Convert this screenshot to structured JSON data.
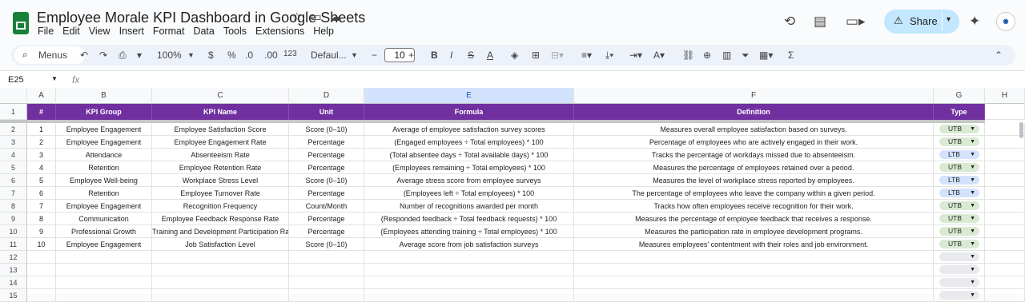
{
  "app": {
    "title": "Employee Morale KPI Dashboard in Google Sheets",
    "menus": [
      "File",
      "Edit",
      "View",
      "Insert",
      "Format",
      "Data",
      "Tools",
      "Extensions",
      "Help"
    ],
    "share_label": "Share"
  },
  "toolbar": {
    "search_label": "Menus",
    "zoom": "100%",
    "currency": "$",
    "percent": "%",
    "dec_decrease": ".0",
    "dec_increase": ".00",
    "number_format": "123",
    "font": "Defaul...",
    "font_size": "10"
  },
  "formula_bar": {
    "cell_ref": "E25",
    "fx": "fx",
    "value": ""
  },
  "columns": [
    "A",
    "B",
    "C",
    "D",
    "E",
    "F",
    "G",
    "H"
  ],
  "selected_column": "E",
  "header_row": {
    "row_number": "1",
    "cells": [
      "#",
      "KPI Group",
      "KPI Name",
      "Unit",
      "Formula",
      "Definition",
      "Type"
    ]
  },
  "rows": [
    {
      "row_number": "2",
      "num": "1",
      "group": "Employee Engagement",
      "name": "Employee Satisfaction Score",
      "unit": "Score (0–10)",
      "formula": "Average of employee satisfaction survey scores",
      "definition": "Measures overall employee satisfaction based on surveys.",
      "type": "UTB"
    },
    {
      "row_number": "3",
      "num": "2",
      "group": "Employee Engagement",
      "name": "Employee Engagement Rate",
      "unit": "Percentage",
      "formula": "(Engaged employees ÷ Total employees) * 100",
      "definition": "Percentage of employees who are actively engaged in their work.",
      "type": "UTB"
    },
    {
      "row_number": "4",
      "num": "3",
      "group": "Attendance",
      "name": "Absenteeism Rate",
      "unit": "Percentage",
      "formula": "(Total absentee days ÷ Total available days) * 100",
      "definition": "Tracks the percentage of workdays missed due to absenteeism.",
      "type": "LTB"
    },
    {
      "row_number": "5",
      "num": "4",
      "group": "Retention",
      "name": "Employee Retention Rate",
      "unit": "Percentage",
      "formula": "(Employees remaining ÷ Total employees) * 100",
      "definition": "Measures the percentage of employees retained over a period.",
      "type": "UTB"
    },
    {
      "row_number": "6",
      "num": "5",
      "group": "Employee Well-being",
      "name": "Workplace Stress Level",
      "unit": "Score (0–10)",
      "formula": "Average stress score from employee surveys",
      "definition": "Measures the level of workplace stress reported by employees.",
      "type": "LTB"
    },
    {
      "row_number": "7",
      "num": "6",
      "group": "Retention",
      "name": "Employee Turnover Rate",
      "unit": "Percentage",
      "formula": "(Employees left ÷ Total employees) * 100",
      "definition": "The percentage of employees who leave the company within a given period.",
      "type": "LTB"
    },
    {
      "row_number": "8",
      "num": "7",
      "group": "Employee Engagement",
      "name": "Recognition Frequency",
      "unit": "Count/Month",
      "formula": "Number of recognitions awarded per month",
      "definition": "Tracks how often employees receive recognition for their work.",
      "type": "UTB"
    },
    {
      "row_number": "9",
      "num": "8",
      "group": "Communication",
      "name": "Employee Feedback Response Rate",
      "unit": "Percentage",
      "formula": "(Responded feedback ÷ Total feedback requests) * 100",
      "definition": "Measures the percentage of employee feedback that receives a response.",
      "type": "UTB"
    },
    {
      "row_number": "10",
      "num": "9",
      "group": "Professional Growth",
      "name": "Training and Development Participation Rate",
      "unit": "Percentage",
      "formula": "(Employees attending training ÷ Total employees) * 100",
      "definition": "Measures the participation rate in employee development programs.",
      "type": "UTB"
    },
    {
      "row_number": "11",
      "num": "10",
      "group": "Employee Engagement",
      "name": "Job Satisfaction Level",
      "unit": "Score (0–10)",
      "formula": "Average score from job satisfaction surveys",
      "definition": "Measures employees' contentment with their roles and job environment.",
      "type": "UTB"
    },
    {
      "row_number": "12",
      "num": "",
      "group": "",
      "name": "",
      "unit": "",
      "formula": "",
      "definition": "",
      "type": ""
    },
    {
      "row_number": "13",
      "num": "",
      "group": "",
      "name": "",
      "unit": "",
      "formula": "",
      "definition": "",
      "type": ""
    },
    {
      "row_number": "14",
      "num": "",
      "group": "",
      "name": "",
      "unit": "",
      "formula": "",
      "definition": "",
      "type": ""
    },
    {
      "row_number": "15",
      "num": "",
      "group": "",
      "name": "",
      "unit": "",
      "formula": "",
      "definition": "",
      "type": ""
    }
  ],
  "colors": {
    "header_bg": "#7030a0",
    "utb_chip": "#d9ead3",
    "ltb_chip": "#d3e3fd",
    "empty_chip": "#e8eaed",
    "share_bg": "#c2e7ff"
  },
  "icons": [
    "star-icon",
    "move-folder-icon",
    "cloud-icon",
    "history-icon",
    "comment-icon",
    "video-icon",
    "gemini-icon"
  ]
}
